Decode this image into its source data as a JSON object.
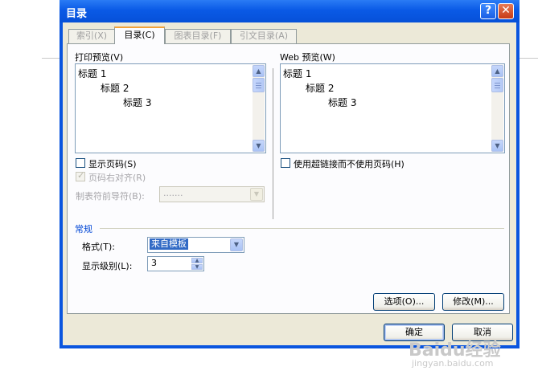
{
  "window": {
    "title": "目录",
    "help_glyph": "?",
    "close_glyph": "✕"
  },
  "tabs": [
    {
      "label": "索引(X)",
      "active": false
    },
    {
      "label": "目录(C)",
      "active": true
    },
    {
      "label": "图表目录(F)",
      "active": false
    },
    {
      "label": "引文目录(A)",
      "active": false
    }
  ],
  "print_preview": {
    "label": "打印预览(V)",
    "lines": [
      "标题 1",
      "标题 2",
      "标题 3"
    ]
  },
  "web_preview": {
    "label": "Web 预览(W)",
    "lines": [
      "标题 1",
      "标题 2",
      "标题 3"
    ]
  },
  "options_left": {
    "show_page_numbers": "显示页码(S)",
    "right_align": "页码右对齐(R)",
    "tab_leader_label": "制表符前导符(B):",
    "tab_leader_value": "......."
  },
  "options_right": {
    "use_hyperlinks": "使用超链接而不使用页码(H)"
  },
  "general": {
    "group_label": "常规",
    "format_label": "格式(T):",
    "format_value": "来自模板",
    "levels_label": "显示级别(L):",
    "levels_value": "3"
  },
  "buttons": {
    "options": "选项(O)...",
    "modify": "修改(M)...",
    "ok": "确定",
    "cancel": "取消"
  },
  "watermark": {
    "logo": "Baidu经验",
    "url": "jingyan.baidu.com"
  }
}
